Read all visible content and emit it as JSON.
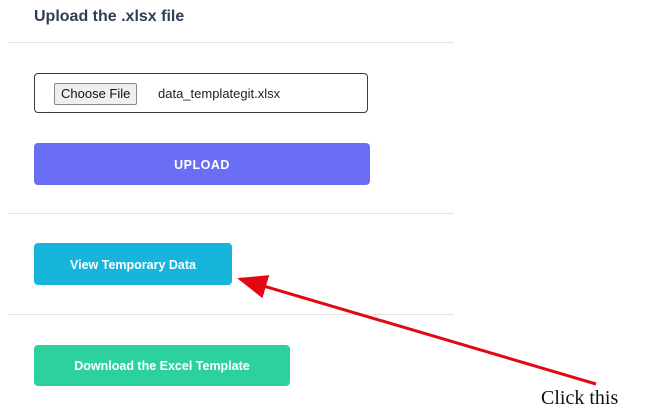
{
  "upload_section": {
    "title": "Upload the .xlsx file",
    "choose_file_label": "Choose File",
    "selected_file": "data_templategit.xlsx",
    "upload_label": "UPLOAD"
  },
  "actions": {
    "view_temp_label": "View Temporary Data",
    "download_template_label": "Download the Excel Template"
  },
  "annotation": {
    "text": "Click this",
    "arrow_color": "#e30613"
  },
  "colors": {
    "title": "#2f3d55",
    "upload_button": "#6a6ef5",
    "view_button": "#17b5dc",
    "download_button": "#2dd1a0"
  }
}
